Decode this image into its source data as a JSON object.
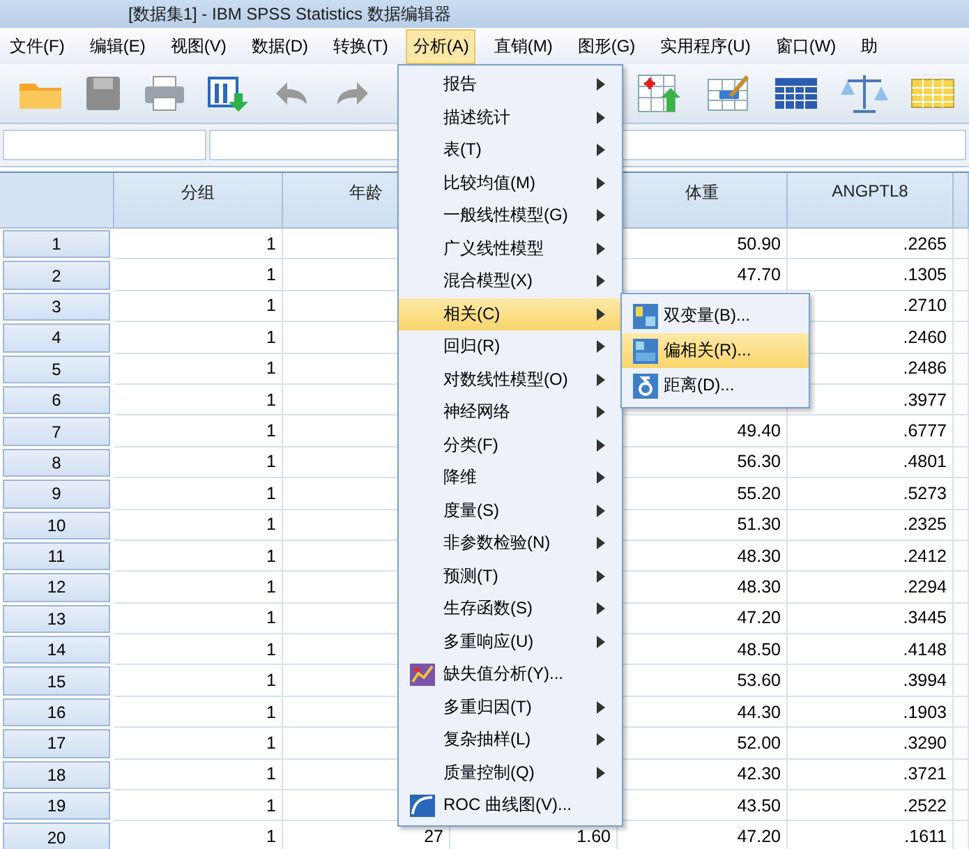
{
  "window": {
    "title": "[数据集1] - IBM SPSS Statistics 数据编辑器"
  },
  "menu_bar": [
    {
      "label": "文件(F)",
      "selected": false
    },
    {
      "label": "编辑(E)",
      "selected": false
    },
    {
      "label": "视图(V)",
      "selected": false
    },
    {
      "label": "数据(D)",
      "selected": false
    },
    {
      "label": "转换(T)",
      "selected": false
    },
    {
      "label": "分析(A)",
      "selected": true
    },
    {
      "label": "直销(M)",
      "selected": false
    },
    {
      "label": "图形(G)",
      "selected": false
    },
    {
      "label": "实用程序(U)",
      "selected": false
    },
    {
      "label": "窗口(W)",
      "selected": false
    },
    {
      "label": "助",
      "selected": false
    }
  ],
  "table": {
    "columns": [
      "分组",
      "年龄",
      null,
      "体重",
      "ANGPTL8"
    ],
    "rows": [
      {
        "number": "1",
        "cells": [
          "1",
          null,
          null,
          "50.90",
          ".2265"
        ]
      },
      {
        "number": "2",
        "cells": [
          "1",
          null,
          null,
          "47.70",
          ".1305"
        ]
      },
      {
        "number": "3",
        "cells": [
          "1",
          null,
          null,
          null,
          ".2710"
        ]
      },
      {
        "number": "4",
        "cells": [
          "1",
          null,
          null,
          null,
          ".2460"
        ]
      },
      {
        "number": "5",
        "cells": [
          "1",
          null,
          null,
          null,
          ".2486"
        ]
      },
      {
        "number": "6",
        "cells": [
          "1",
          null,
          null,
          null,
          ".3977"
        ]
      },
      {
        "number": "7",
        "cells": [
          "1",
          null,
          null,
          "49.40",
          ".6777"
        ]
      },
      {
        "number": "8",
        "cells": [
          "1",
          null,
          null,
          "56.30",
          ".4801"
        ]
      },
      {
        "number": "9",
        "cells": [
          "1",
          null,
          null,
          "55.20",
          ".5273"
        ]
      },
      {
        "number": "10",
        "cells": [
          "1",
          null,
          null,
          "51.30",
          ".2325"
        ]
      },
      {
        "number": "11",
        "cells": [
          "1",
          null,
          null,
          "48.30",
          ".2412"
        ]
      },
      {
        "number": "12",
        "cells": [
          "1",
          null,
          null,
          "48.30",
          ".2294"
        ]
      },
      {
        "number": "13",
        "cells": [
          "1",
          null,
          null,
          "47.20",
          ".3445"
        ]
      },
      {
        "number": "14",
        "cells": [
          "1",
          null,
          null,
          "48.50",
          ".4148"
        ]
      },
      {
        "number": "15",
        "cells": [
          "1",
          null,
          null,
          "53.60",
          ".3994"
        ]
      },
      {
        "number": "16",
        "cells": [
          "1",
          null,
          null,
          "44.30",
          ".1903"
        ]
      },
      {
        "number": "17",
        "cells": [
          "1",
          null,
          null,
          "52.00",
          ".3290"
        ]
      },
      {
        "number": "18",
        "cells": [
          "1",
          null,
          null,
          "42.30",
          ".3721"
        ]
      },
      {
        "number": "19",
        "cells": [
          "1",
          null,
          null,
          "43.50",
          ".2522"
        ]
      },
      {
        "number": "20",
        "cells": [
          "1",
          "27",
          "1.60",
          "47.20",
          ".1611"
        ]
      }
    ]
  },
  "analyze_menu": [
    {
      "label": "报告",
      "kind": "submenu",
      "selected": false
    },
    {
      "label": "描述统计",
      "kind": "submenu",
      "selected": false
    },
    {
      "label": "表(T)",
      "kind": "submenu",
      "selected": false
    },
    {
      "label": "比较均值(M)",
      "kind": "submenu",
      "selected": false
    },
    {
      "label": "一般线性模型(G)",
      "kind": "submenu",
      "selected": false
    },
    {
      "label": "广义线性模型",
      "kind": "submenu",
      "selected": false
    },
    {
      "label": "混合模型(X)",
      "kind": "submenu",
      "selected": false
    },
    {
      "label": "相关(C)",
      "kind": "submenu",
      "selected": true
    },
    {
      "label": "回归(R)",
      "kind": "submenu",
      "selected": false
    },
    {
      "label": "对数线性模型(O)",
      "kind": "submenu",
      "selected": false
    },
    {
      "label": "神经网络",
      "kind": "submenu",
      "selected": false
    },
    {
      "label": "分类(F)",
      "kind": "submenu",
      "selected": false
    },
    {
      "label": "降维",
      "kind": "submenu",
      "selected": false
    },
    {
      "label": "度量(S)",
      "kind": "submenu",
      "selected": false
    },
    {
      "label": "非参数检验(N)",
      "kind": "submenu",
      "selected": false
    },
    {
      "label": "预测(T)",
      "kind": "submenu",
      "selected": false
    },
    {
      "label": "生存函数(S)",
      "kind": "submenu",
      "selected": false
    },
    {
      "label": "多重响应(U)",
      "kind": "submenu",
      "selected": false
    },
    {
      "label": "缺失值分析(Y)...",
      "kind": "missing",
      "selected": false
    },
    {
      "label": "多重归因(T)",
      "kind": "submenu",
      "selected": false
    },
    {
      "label": "复杂抽样(L)",
      "kind": "submenu",
      "selected": false
    },
    {
      "label": "质量控制(Q)",
      "kind": "submenu",
      "selected": false
    },
    {
      "label": "ROC 曲线图(V)...",
      "kind": "roc",
      "selected": false
    }
  ],
  "correlate_submenu": [
    {
      "label": "双变量(B)...",
      "kind": "bivariate",
      "selected": false
    },
    {
      "label": "偏相关(R)...",
      "kind": "partial",
      "selected": true
    },
    {
      "label": "距离(D)...",
      "kind": "distance",
      "selected": false
    }
  ]
}
